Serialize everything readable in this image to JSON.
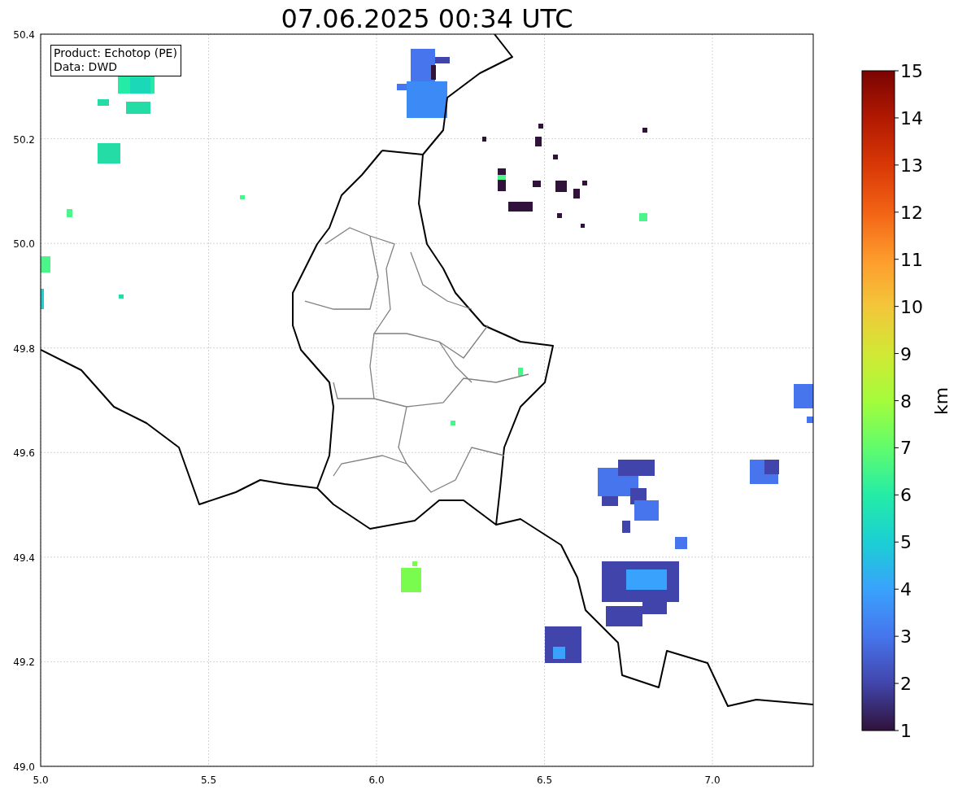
{
  "title": "07.06.2025 00:34 UTC",
  "annotation": [
    "Product: Echotop (PE)",
    "Data: DWD"
  ],
  "axes": {
    "xticks": [
      "5.0",
      "5.5",
      "6.0",
      "6.5",
      "7.0"
    ],
    "yticks": [
      "50.4",
      "50.2",
      "50.0",
      "49.8",
      "49.6",
      "49.4",
      "49.2",
      "49.0"
    ]
  },
  "colorbar": {
    "label": "km",
    "ticks": [
      "15",
      "14",
      "13",
      "12",
      "11",
      "10",
      "9",
      "8",
      "7",
      "6",
      "5",
      "4",
      "3",
      "2",
      "1"
    ]
  }
}
